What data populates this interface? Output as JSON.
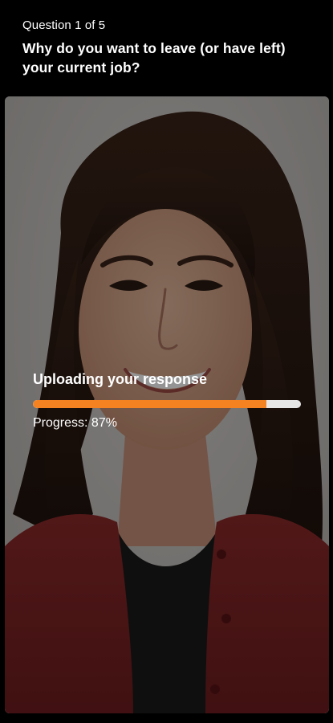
{
  "question": {
    "counter": "Question 1 of 5",
    "text": "Why do you want to leave (or have left) your current job?"
  },
  "video": {
    "subject": "smiling woman with long dark hair in red cardigan",
    "icon": "recorded-video-preview"
  },
  "upload": {
    "title": "Uploading your response",
    "progress_label": "Progress: 87%",
    "progress_value": 0.87
  },
  "colors": {
    "accent": "#f58220",
    "track": "#e6e6e6",
    "background": "#000000"
  }
}
